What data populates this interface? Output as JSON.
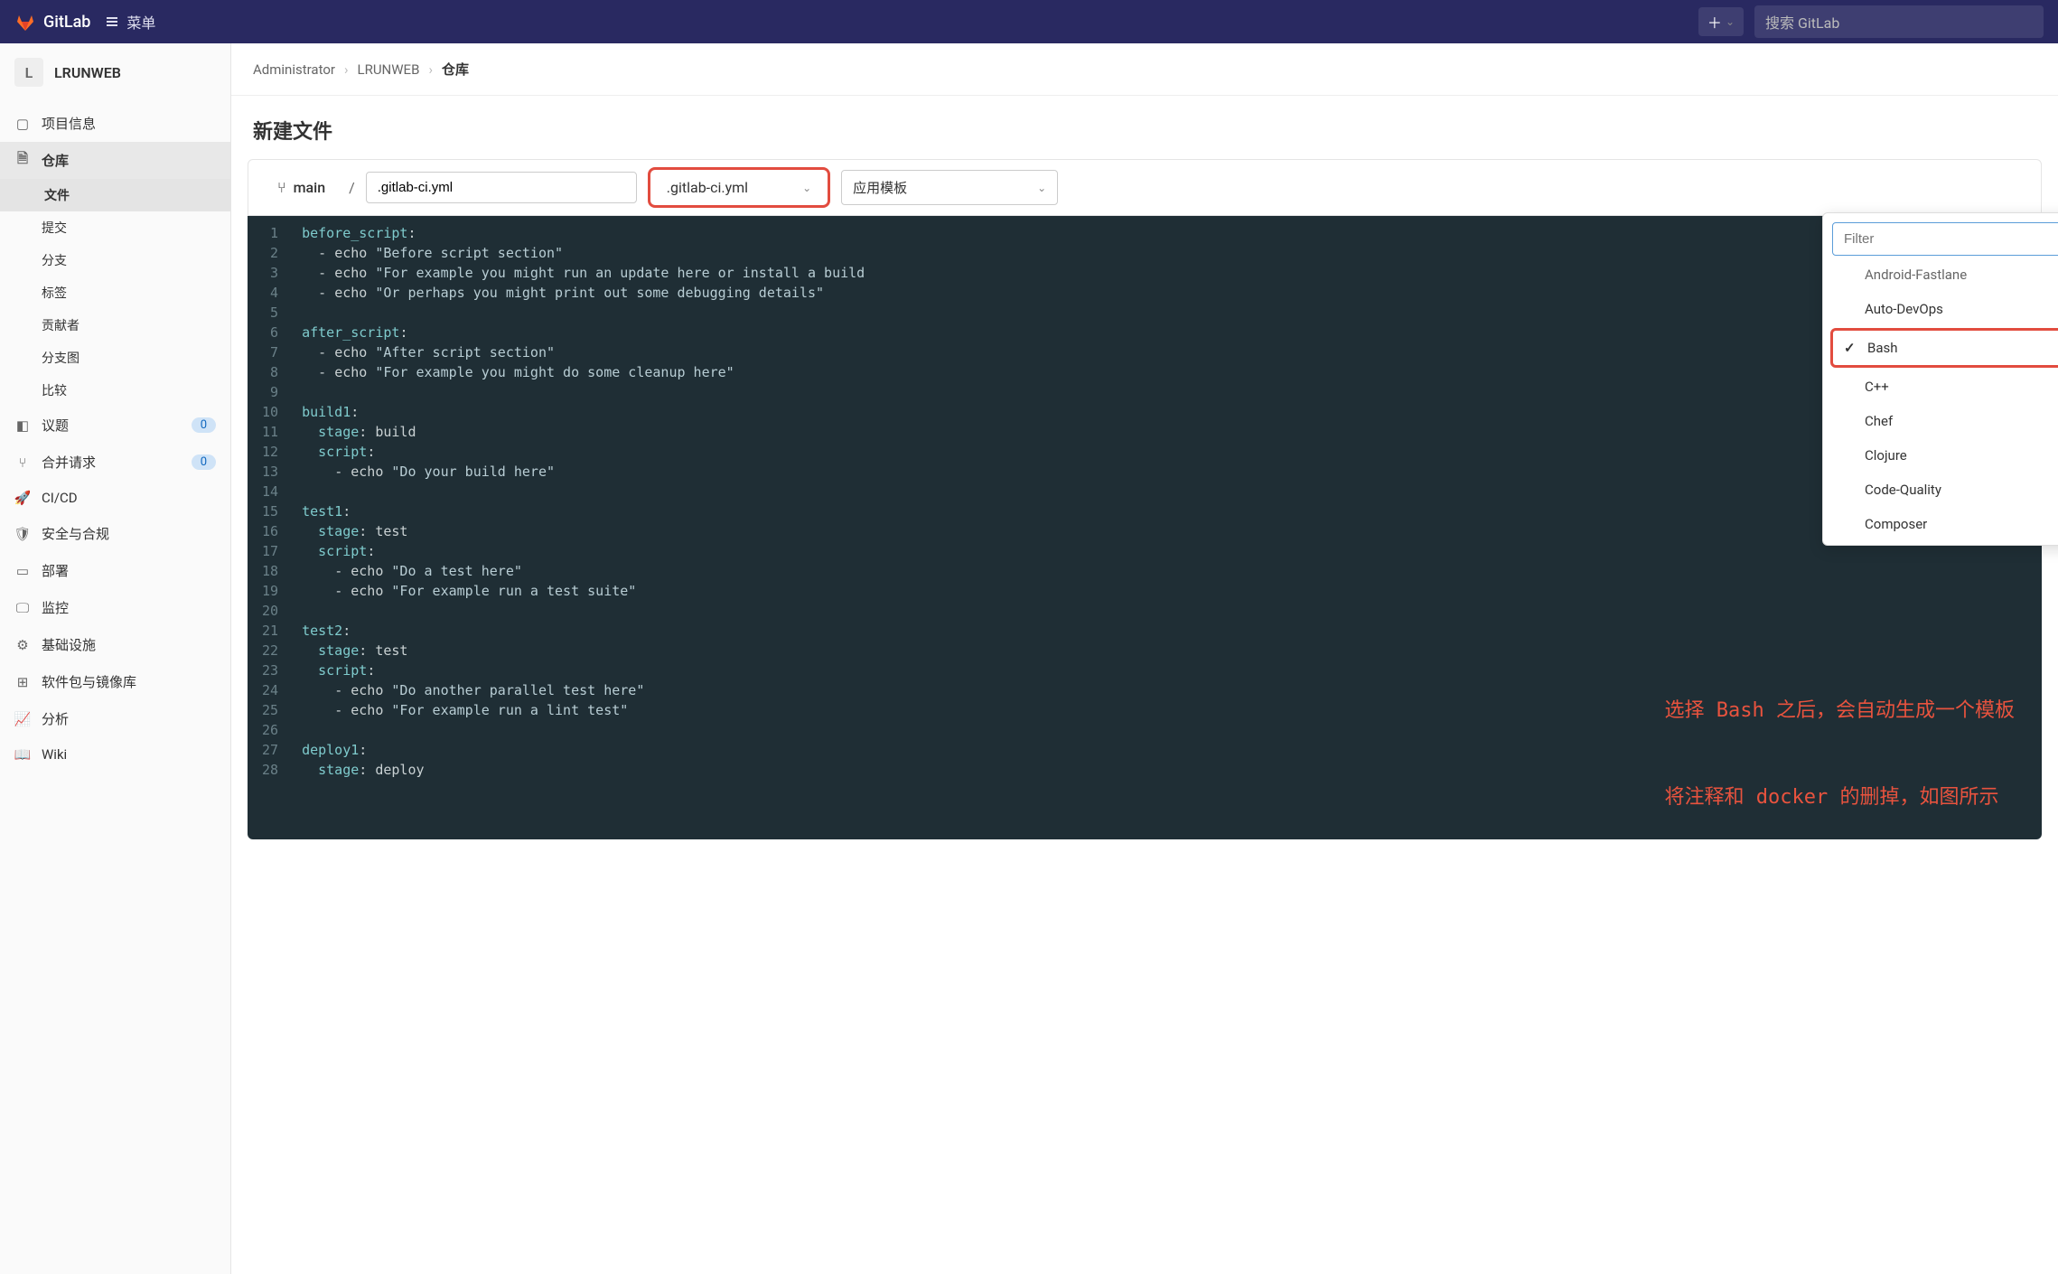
{
  "navbar": {
    "brand": "GitLab",
    "menu": "菜单",
    "search_placeholder": "搜索 GitLab"
  },
  "project": {
    "avatar_letter": "L",
    "name": "LRUNWEB"
  },
  "sidebar": {
    "items": [
      {
        "icon": "info",
        "label": "项目信息"
      },
      {
        "icon": "repo",
        "label": "仓库"
      },
      {
        "icon": "issues",
        "label": "议题",
        "count": "0"
      },
      {
        "icon": "merge",
        "label": "合并请求",
        "count": "0"
      },
      {
        "icon": "cicd",
        "label": "CI/CD"
      },
      {
        "icon": "shield",
        "label": "安全与合规"
      },
      {
        "icon": "deploy",
        "label": "部署"
      },
      {
        "icon": "monitor",
        "label": "监控"
      },
      {
        "icon": "infra",
        "label": "基础设施"
      },
      {
        "icon": "package",
        "label": "软件包与镜像库"
      },
      {
        "icon": "analytics",
        "label": "分析"
      },
      {
        "icon": "wiki",
        "label": "Wiki"
      }
    ],
    "repo_subs": [
      "文件",
      "提交",
      "分支",
      "标签",
      "贡献者",
      "分支图",
      "比较"
    ]
  },
  "breadcrumb": {
    "a": "Administrator",
    "b": "LRUNWEB",
    "c": "仓库"
  },
  "page": {
    "title": "新建文件"
  },
  "toolbar": {
    "branch": "main",
    "filename": ".gitlab-ci.yml",
    "template_label": ".gitlab-ci.yml",
    "apply_template": "应用模板"
  },
  "dropdown": {
    "filter_placeholder": "Filter",
    "items": [
      "Android-Fastlane",
      "Auto-DevOps",
      "Bash",
      "C++",
      "Chef",
      "Clojure",
      "Code-Quality",
      "Composer"
    ],
    "selected": "Bash"
  },
  "code": {
    "lines": [
      {
        "n": 1,
        "t": "key",
        "k": "before_script",
        "rest": ":"
      },
      {
        "n": 2,
        "t": "item",
        "s": "  - echo \"Before script section\""
      },
      {
        "n": 3,
        "t": "item",
        "s": "  - echo \"For example you might run an update here or install a build"
      },
      {
        "n": 4,
        "t": "item",
        "s": "  - echo \"Or perhaps you might print out some debugging details\""
      },
      {
        "n": 5,
        "t": "blank"
      },
      {
        "n": 6,
        "t": "key",
        "k": "after_script",
        "rest": ":"
      },
      {
        "n": 7,
        "t": "item",
        "s": "  - echo \"After script section\""
      },
      {
        "n": 8,
        "t": "item",
        "s": "  - echo \"For example you might do some cleanup here\""
      },
      {
        "n": 9,
        "t": "blank"
      },
      {
        "n": 10,
        "t": "name",
        "k": "build1",
        "rest": ":"
      },
      {
        "n": 11,
        "t": "kv",
        "k": "  stage",
        "v": " build"
      },
      {
        "n": 12,
        "t": "key2",
        "k": "  script",
        "rest": ":"
      },
      {
        "n": 13,
        "t": "item",
        "s": "    - echo \"Do your build here\""
      },
      {
        "n": 14,
        "t": "blank"
      },
      {
        "n": 15,
        "t": "name",
        "k": "test1",
        "rest": ":"
      },
      {
        "n": 16,
        "t": "kv",
        "k": "  stage",
        "v": " test"
      },
      {
        "n": 17,
        "t": "key2",
        "k": "  script",
        "rest": ":"
      },
      {
        "n": 18,
        "t": "item",
        "s": "    - echo \"Do a test here\""
      },
      {
        "n": 19,
        "t": "item",
        "s": "    - echo \"For example run a test suite\""
      },
      {
        "n": 20,
        "t": "blank"
      },
      {
        "n": 21,
        "t": "name",
        "k": "test2",
        "rest": ":"
      },
      {
        "n": 22,
        "t": "kv",
        "k": "  stage",
        "v": " test"
      },
      {
        "n": 23,
        "t": "key2",
        "k": "  script",
        "rest": ":"
      },
      {
        "n": 24,
        "t": "item",
        "s": "    - echo \"Do another parallel test here\""
      },
      {
        "n": 25,
        "t": "item",
        "s": "    - echo \"For example run a lint test\""
      },
      {
        "n": 26,
        "t": "blank"
      },
      {
        "n": 27,
        "t": "name",
        "k": "deploy1",
        "rest": ":"
      },
      {
        "n": 28,
        "t": "kv",
        "k": "  stage",
        "v": " deploy"
      }
    ]
  },
  "annotation": {
    "line1": "选择 Bash 之后，会自动生成一个模板",
    "line2": "将注释和 docker 的删掉，如图所示"
  }
}
